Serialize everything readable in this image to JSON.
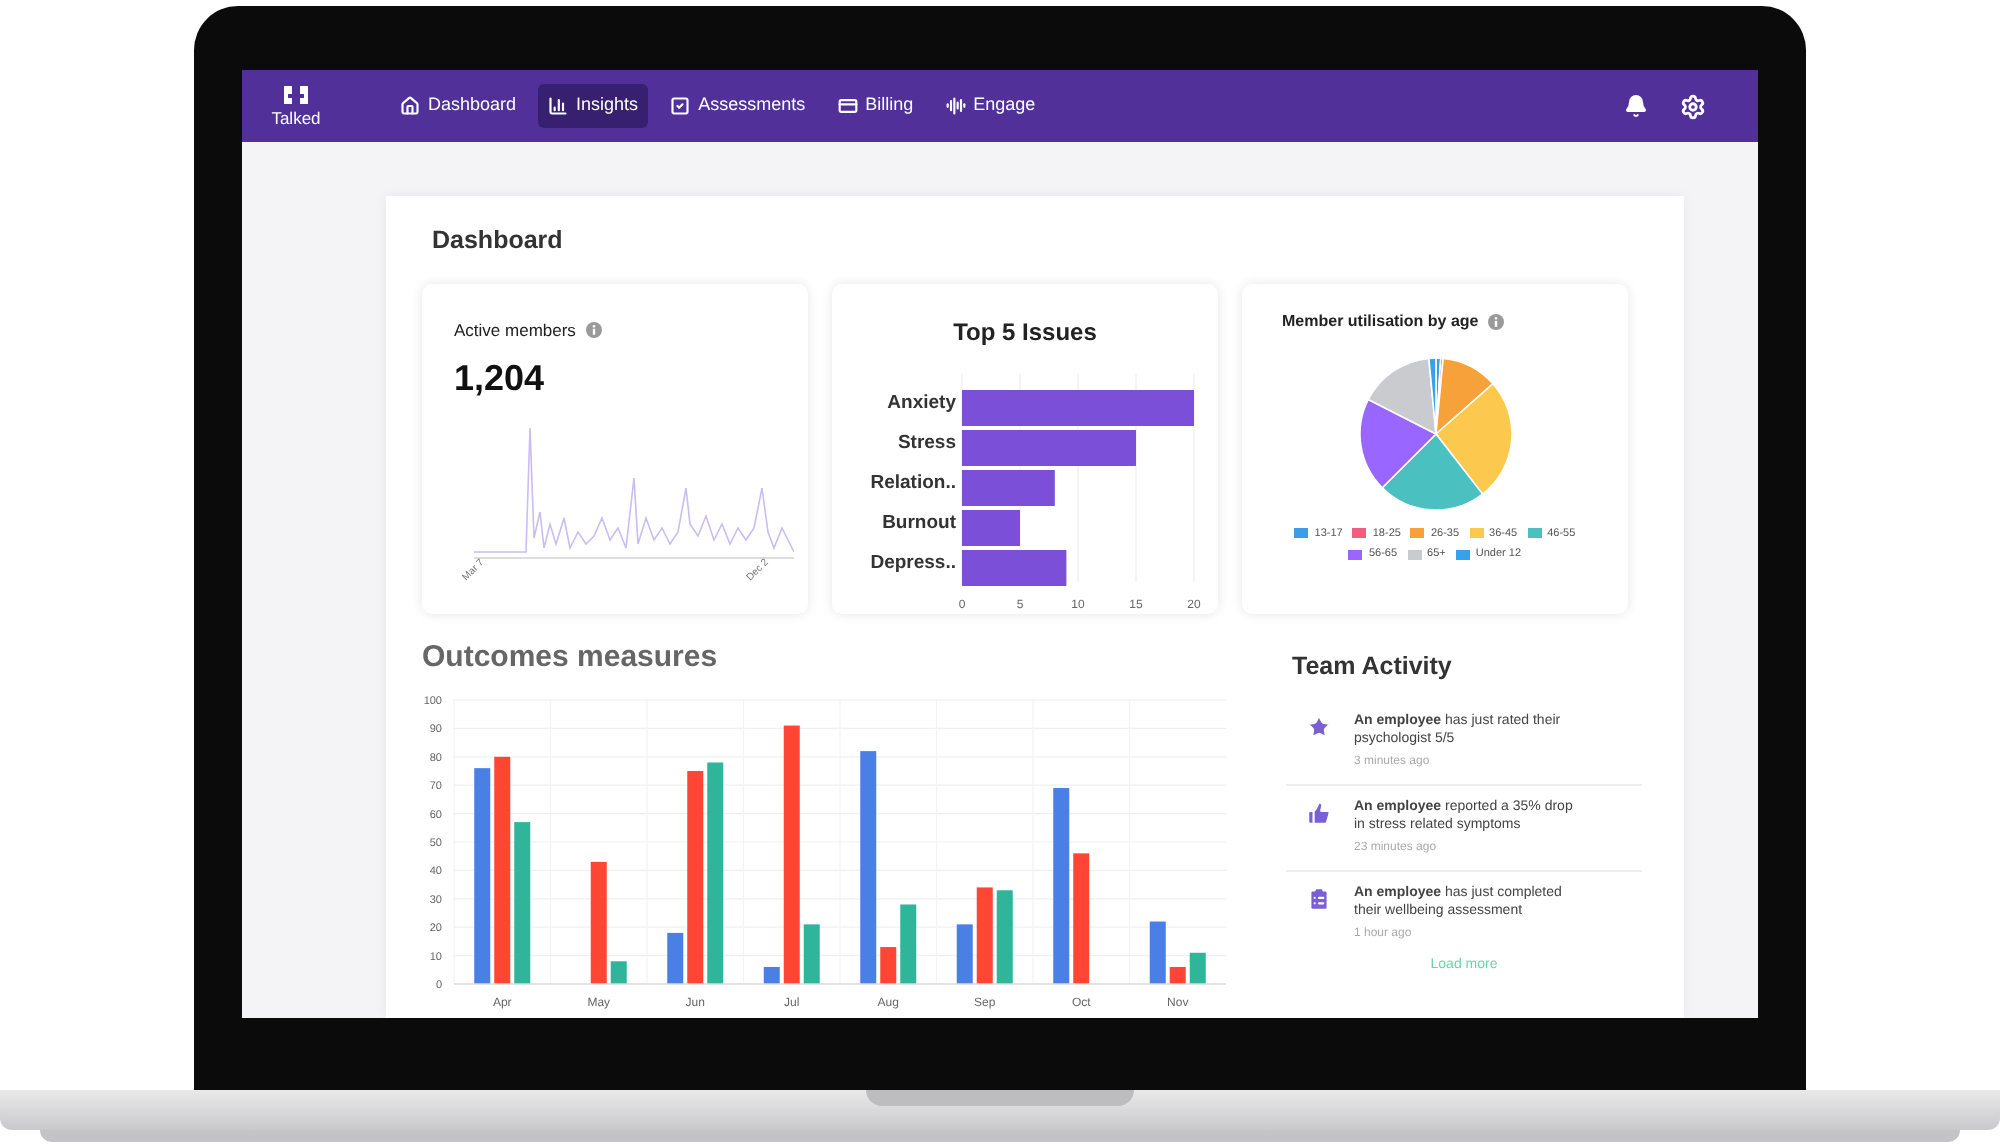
{
  "nav": {
    "logo": "Talked",
    "items": [
      {
        "label": "Dashboard",
        "kind": "home",
        "selected": false
      },
      {
        "label": "Insights",
        "kind": "chart",
        "selected": true
      },
      {
        "label": "Assessments",
        "kind": "check",
        "selected": false
      },
      {
        "label": "Billing",
        "kind": "card",
        "selected": false
      },
      {
        "label": "Engage",
        "kind": "voice",
        "selected": false
      }
    ]
  },
  "page_title": "Dashboard",
  "active_members": {
    "title": "Active members",
    "value": "1,204",
    "x_labels": [
      "Mar 7",
      "Dec 2"
    ]
  },
  "top_issues": {
    "title": "Top 5 Issues",
    "chart_data": {
      "type": "bar",
      "orientation": "horizontal",
      "categories": [
        "Anxiety",
        "Stress",
        "Relation..",
        "Burnout",
        "Depress.."
      ],
      "series": [
        {
          "color": "#7b4fd8",
          "values": [
            20,
            15,
            8,
            5,
            9
          ]
        }
      ],
      "xlim": [
        0,
        20
      ],
      "xticks": [
        0,
        5,
        10,
        15,
        20
      ],
      "grid": true
    }
  },
  "utilisation": {
    "title": "Member utilisation by age",
    "legend": [
      {
        "label": "13-17",
        "color": "#3b9de8"
      },
      {
        "label": "18-25",
        "color": "#f25d7e"
      },
      {
        "label": "26-35",
        "color": "#f7a13b"
      },
      {
        "label": "36-45",
        "color": "#fcc94e"
      },
      {
        "label": "46-55",
        "color": "#4bc0c0"
      },
      {
        "label": "56-65",
        "color": "#9966ff"
      },
      {
        "label": "65+",
        "color": "#c9cbcf"
      },
      {
        "label": "Under 12",
        "color": "#36a2eb"
      }
    ]
  },
  "outcomes": {
    "title": "Outcomes measures",
    "chart_data": {
      "type": "bar",
      "categories": [
        "Apr",
        "May",
        "Jun",
        "Jul",
        "Aug",
        "Sep",
        "Oct",
        "Nov"
      ],
      "series": [
        {
          "color": "#4a7fe6",
          "values": [
            76,
            null,
            18,
            6,
            82,
            21,
            69,
            22
          ]
        },
        {
          "color": "#ff4533",
          "values": [
            80,
            43,
            75,
            91,
            13,
            34,
            46,
            6
          ]
        },
        {
          "color": "#2fb59a",
          "values": [
            57,
            8,
            78,
            21,
            28,
            33,
            null,
            11
          ]
        }
      ],
      "ylim": [
        0,
        100
      ],
      "grid": true,
      "yticks": [
        0,
        10,
        20,
        30,
        40,
        50,
        60,
        70,
        80,
        90,
        100
      ]
    }
  },
  "team_activity": {
    "title": "Team Activity",
    "items": [
      {
        "kind": "star",
        "text": "**An employee** has just rated their psychologist 5/5",
        "time": "3 minutes ago"
      },
      {
        "kind": "thumb",
        "text": "**An employee** reported a 35% drop in stress related symptoms",
        "time": "23 minutes ago"
      },
      {
        "kind": "clipboard",
        "text": "**An employee** has just completed their wellbeing assessment",
        "time": "1 hour ago"
      }
    ],
    "load_more": "Load more"
  }
}
